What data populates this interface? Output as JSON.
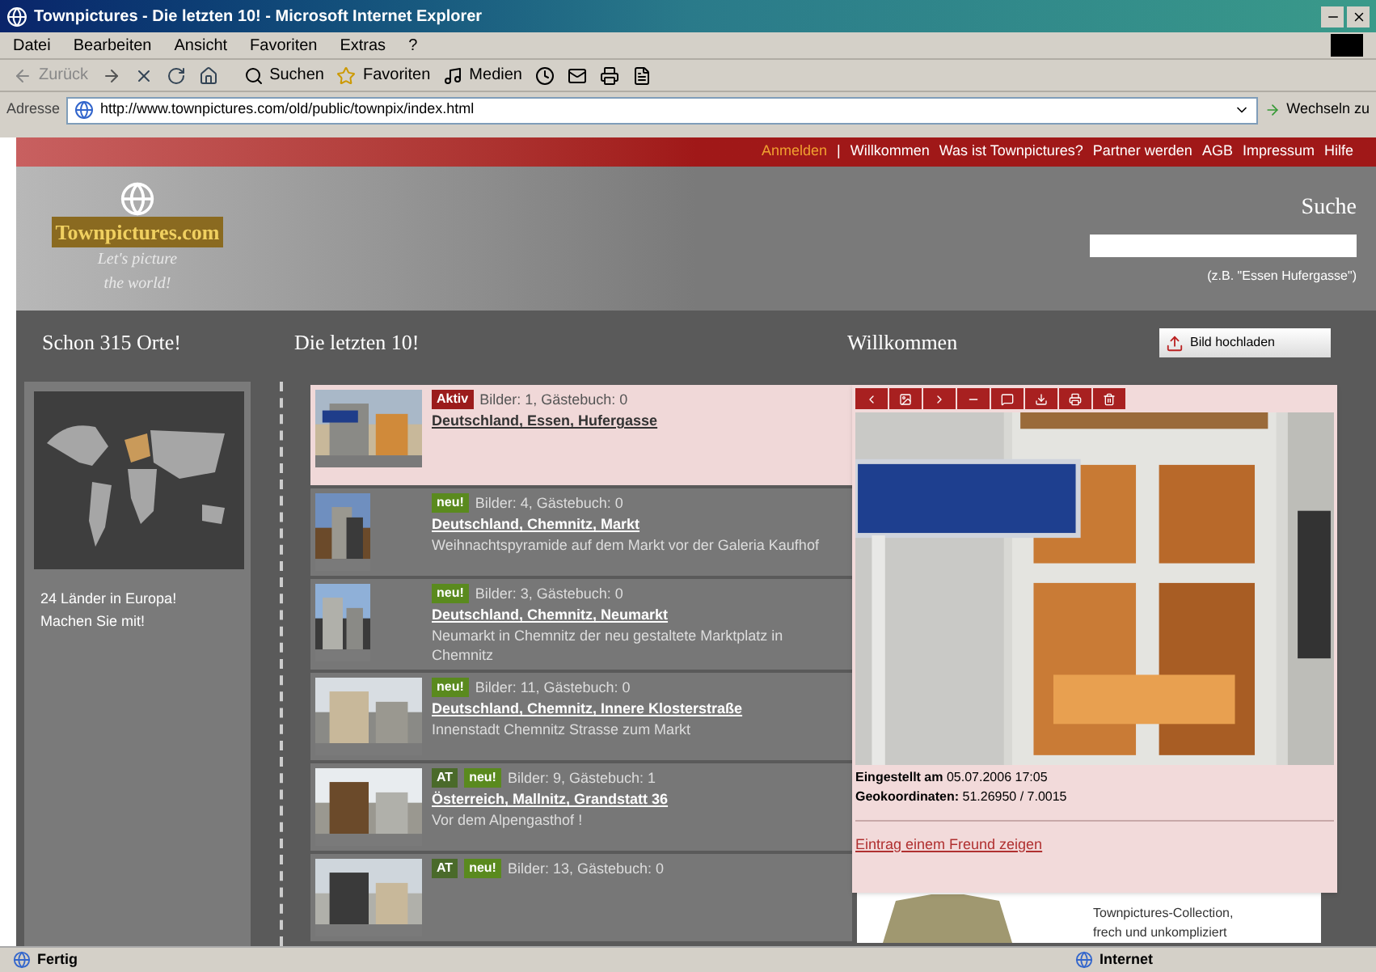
{
  "window": {
    "title": "Townpictures - Die letzten 10! - Microsoft Internet Explorer"
  },
  "menu": [
    "Datei",
    "Bearbeiten",
    "Ansicht",
    "Favoriten",
    "Extras",
    "?"
  ],
  "toolbar": {
    "back": "Zurück",
    "search": "Suchen",
    "favorites": "Favoriten",
    "media": "Medien"
  },
  "address": {
    "label": "Adresse",
    "value": "http://www.townpictures.com/old/public/townpix/index.html",
    "go": "Wechseln zu"
  },
  "top_links": [
    {
      "label": "Anmelden",
      "kind": "highlight"
    },
    {
      "label": "|",
      "kind": "separator"
    },
    {
      "label": "Willkommen",
      "kind": "link"
    },
    {
      "label": "Was ist Townpictures?",
      "kind": "link"
    },
    {
      "label": "Partner werden",
      "kind": "link"
    },
    {
      "label": "AGB",
      "kind": "link"
    },
    {
      "label": "Impressum",
      "kind": "link"
    },
    {
      "label": "Hilfe",
      "kind": "link"
    }
  ],
  "logo": {
    "name": "Townpictures.com",
    "slogan_1": "Let's picture",
    "slogan_2": "the world!"
  },
  "search": {
    "title": "Suche",
    "hint": "(z.B. \"Essen Hufergasse\")"
  },
  "sections": {
    "places": "Schon 315 Orte!",
    "latest": "Die letzten 10!",
    "welcome": "Willkommen",
    "upload": "Bild hochladen"
  },
  "map_caption": "24 Länder in Europa! Machen Sie mit!",
  "entries": [
    {
      "selected": true,
      "badges": [
        {
          "label": "Aktiv",
          "color": "#9b1c1c"
        }
      ],
      "stats": "Bilder: 1, Gästebuch: 0",
      "place": "Deutschland, Essen, Hufergasse"
    },
    {
      "selected": false,
      "badges": [
        {
          "label": "neu!",
          "color": "#5a8a1e"
        }
      ],
      "stats": "Bilder: 4, Gästebuch: 0",
      "place": "Deutschland, Chemnitz, Markt",
      "description": "Weihnachtspyramide auf dem Markt vor der Galeria Kaufhof"
    },
    {
      "selected": false,
      "badges": [
        {
          "label": "neu!",
          "color": "#5a8a1e"
        }
      ],
      "stats": "Bilder: 3, Gästebuch: 0",
      "place": "Deutschland, Chemnitz, Neumarkt",
      "description": "Neumarkt in Chemnitz der neu gestaltete Marktplatz in Chemnitz"
    },
    {
      "selected": false,
      "badges": [
        {
          "label": "neu!",
          "color": "#5a8a1e"
        }
      ],
      "stats": "Bilder: 11, Gästebuch: 0",
      "place": "Deutschland, Chemnitz, Innere Klosterstraße",
      "description": "Innenstadt Chemnitz Strasse zum Markt"
    },
    {
      "selected": false,
      "badges": [
        {
          "label": "AT",
          "color": "#4a6a2a"
        },
        {
          "label": "neu!",
          "color": "#5a8a1e"
        }
      ],
      "stats": "Bilder: 9, Gästebuch: 1",
      "place": "Österreich, Mallnitz, Grandstatt 36",
      "description": "Vor dem Alpengasthof !"
    },
    {
      "selected": false,
      "badges": [
        {
          "label": "AT",
          "color": "#4a6a2a"
        },
        {
          "label": "neu!",
          "color": "#5a8a1e"
        }
      ],
      "stats": "Bilder: 13, Gästebuch: 0"
    }
  ],
  "popup": {
    "posted": "Eingestellt am",
    "posted_value": "05.07.2006 17:05",
    "geo": "Geokoordinaten:",
    "geo_value": "51.26950 / 7.0015",
    "share": "Eintrag einem Freund zeigen"
  },
  "promo": {
    "line_1": "Townpictures-Collection,",
    "line_2": "frech und unkompliziert"
  },
  "status": {
    "text": "Fertig",
    "zone": "Internet"
  }
}
